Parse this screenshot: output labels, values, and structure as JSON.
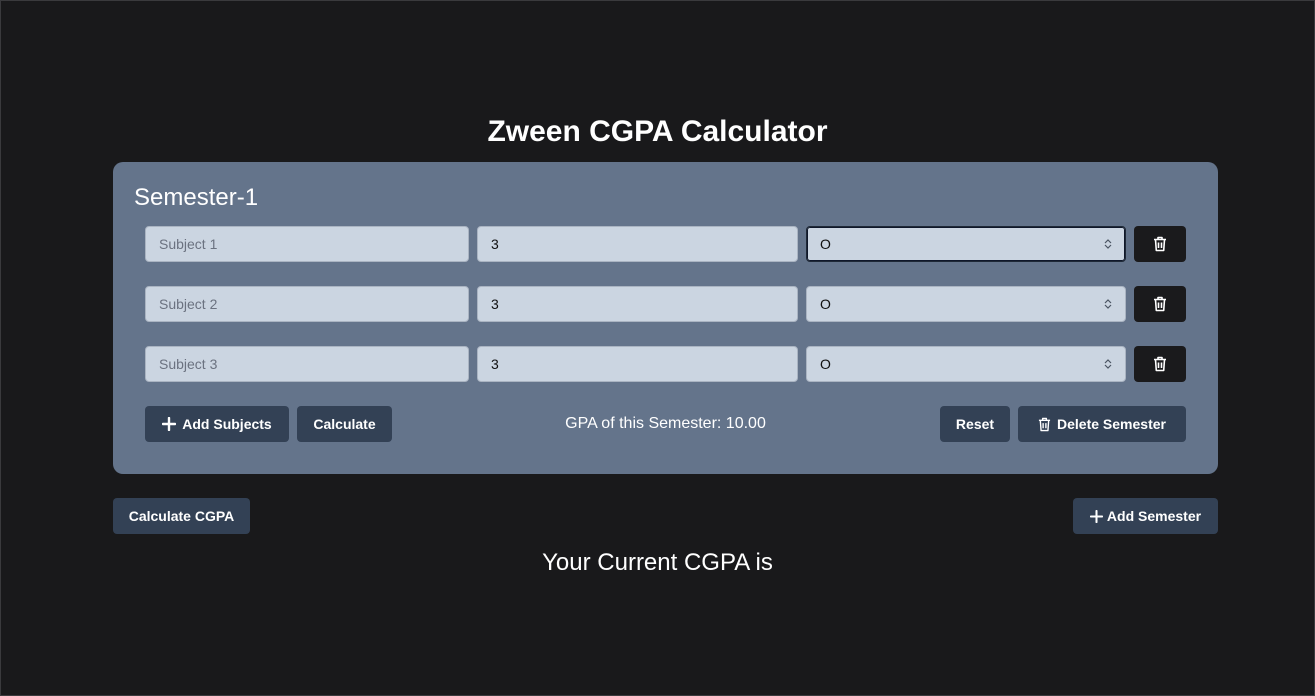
{
  "app": {
    "title": "Zween CGPA Calculator"
  },
  "semester": {
    "title": "Semester-1",
    "subjects": [
      {
        "name_placeholder": "Subject 1",
        "credits": "3",
        "grade": "O"
      },
      {
        "name_placeholder": "Subject 2",
        "credits": "3",
        "grade": "O"
      },
      {
        "name_placeholder": "Subject 3",
        "credits": "3",
        "grade": "O"
      }
    ],
    "add_subjects_label": "Add Subjects",
    "calculate_label": "Calculate",
    "gpa_text": "GPA of this Semester: 10.00",
    "reset_label": "Reset",
    "delete_semester_label": "Delete Semester"
  },
  "footer": {
    "calculate_cgpa_label": "Calculate CGPA",
    "add_semester_label": "Add Semester",
    "cgpa_text": "Your Current CGPA is"
  },
  "colors": {
    "background": "#19191b",
    "card": "#64748b",
    "input": "#cbd5e1",
    "button": "#334155",
    "delete_button": "#1a1a1c"
  },
  "icons": {
    "trash": "trash-icon",
    "plus": "plus-icon",
    "select_arrows": "chevron-up-down-icon"
  }
}
